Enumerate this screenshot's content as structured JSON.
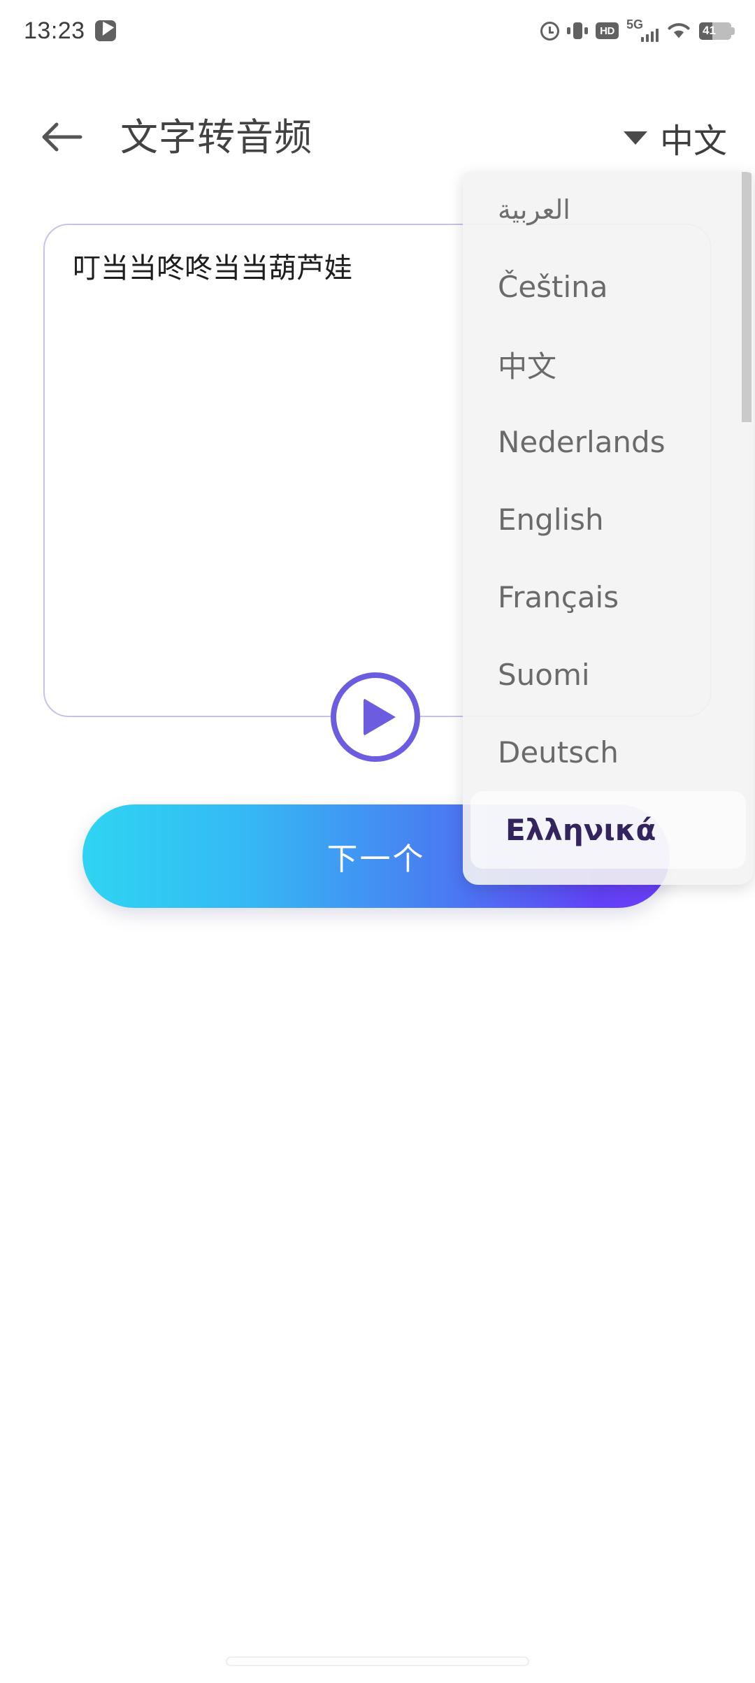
{
  "status_bar": {
    "time": "13:23",
    "app_badge_icon": "app-badge-icon",
    "icons": [
      "alarm-icon",
      "vibrate-icon",
      "hd-icon",
      "5g-signal-icon",
      "wifi-icon",
      "battery-icon"
    ],
    "hd_label": "HD",
    "network_label": "5G",
    "battery_level": "41"
  },
  "app_bar": {
    "back_icon": "back-arrow-icon",
    "title": "文字转音频",
    "language_selector": {
      "caret_icon": "caret-down-icon",
      "value": "中文"
    }
  },
  "editor": {
    "text_value": "叮当当咚咚当当葫芦娃",
    "placeholder": ""
  },
  "player": {
    "play_icon": "play-icon"
  },
  "primary_action": {
    "label": "下一个",
    "gradient_from": "#2ed5f2",
    "gradient_to": "#6b3ef6"
  },
  "language_dropdown": {
    "scrollbar": "vertical-scrollbar",
    "selected_index": 8,
    "items": [
      {
        "label": "العربية",
        "rtl": true
      },
      {
        "label": "Čeština",
        "rtl": false
      },
      {
        "label": "中文",
        "rtl": false
      },
      {
        "label": "Nederlands",
        "rtl": false
      },
      {
        "label": "English",
        "rtl": false
      },
      {
        "label": "Français",
        "rtl": false
      },
      {
        "label": "Suomi",
        "rtl": false
      },
      {
        "label": "Deutsch",
        "rtl": false
      },
      {
        "label": "Ελληνικά",
        "rtl": false
      }
    ]
  },
  "system_nav": {
    "gesture_bar": "home-gesture-bar"
  },
  "colors": {
    "accent_purple": "#6b5ce0",
    "border_lavender": "#c9c2e8",
    "status_gray": "#616161"
  }
}
